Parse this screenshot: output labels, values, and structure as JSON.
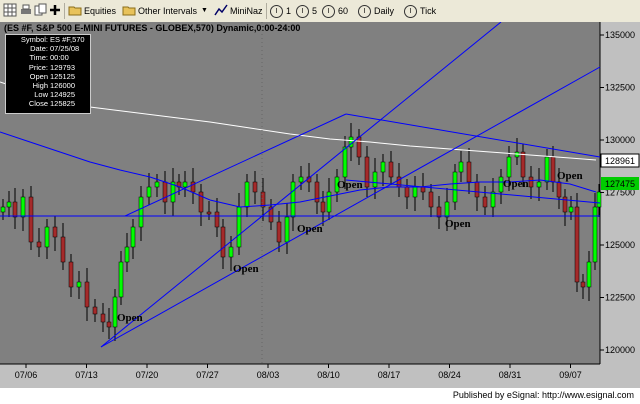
{
  "toolbar": {
    "equities": "Equities",
    "other_intervals": "Other Intervals",
    "mininaz": "MiniNaz",
    "iv1": "1",
    "iv5": "5",
    "iv60": "60",
    "daily": "Daily",
    "tick": "Tick",
    "interval_badge": "I"
  },
  "chart": {
    "title": "(ES #F,  S&P 500 E-MINI FUTURES - GLOBEX,570) Dynamic,0:00-24:00",
    "last_price_badge": "128961",
    "close_badge": "127475",
    "annotations": [
      "Open",
      "Open",
      "Open",
      "Open",
      "Open",
      "Open",
      "Open"
    ]
  },
  "info_panel": {
    "rows": [
      {
        "k": "Symbol:",
        "v": "ES #F,570"
      },
      {
        "k": "Date:",
        "v": "07/25/08"
      },
      {
        "k": "Time:",
        "v": "00:00"
      },
      {
        "k": "Price:",
        "v": "129793"
      },
      {
        "k": "Open",
        "v": "125125"
      },
      {
        "k": "High",
        "v": "126000"
      },
      {
        "k": "Low",
        "v": "124925"
      },
      {
        "k": "Close",
        "v": "125825"
      }
    ]
  },
  "footer": {
    "text": "Published by eSignal: http://www.esignal.com"
  },
  "colors": {
    "plot_bg": "#808080",
    "up": "#00ff00",
    "down": "#a52a2a",
    "trendline": "#0000ff",
    "ma_white": "#ffffff",
    "ma_blue": "#0000ff"
  },
  "chart_data": {
    "type": "candlestick",
    "y_ticks": [
      "135000",
      "132500",
      "130000",
      "127500",
      "125000",
      "122500",
      "120000"
    ],
    "x_ticks": [
      "07/06",
      "07/13",
      "07/20",
      "07/27",
      "08/03",
      "08/10",
      "08/17",
      "08/24",
      "08/31",
      "09/07"
    ],
    "ylim": [
      119500,
      136500
    ]
  }
}
